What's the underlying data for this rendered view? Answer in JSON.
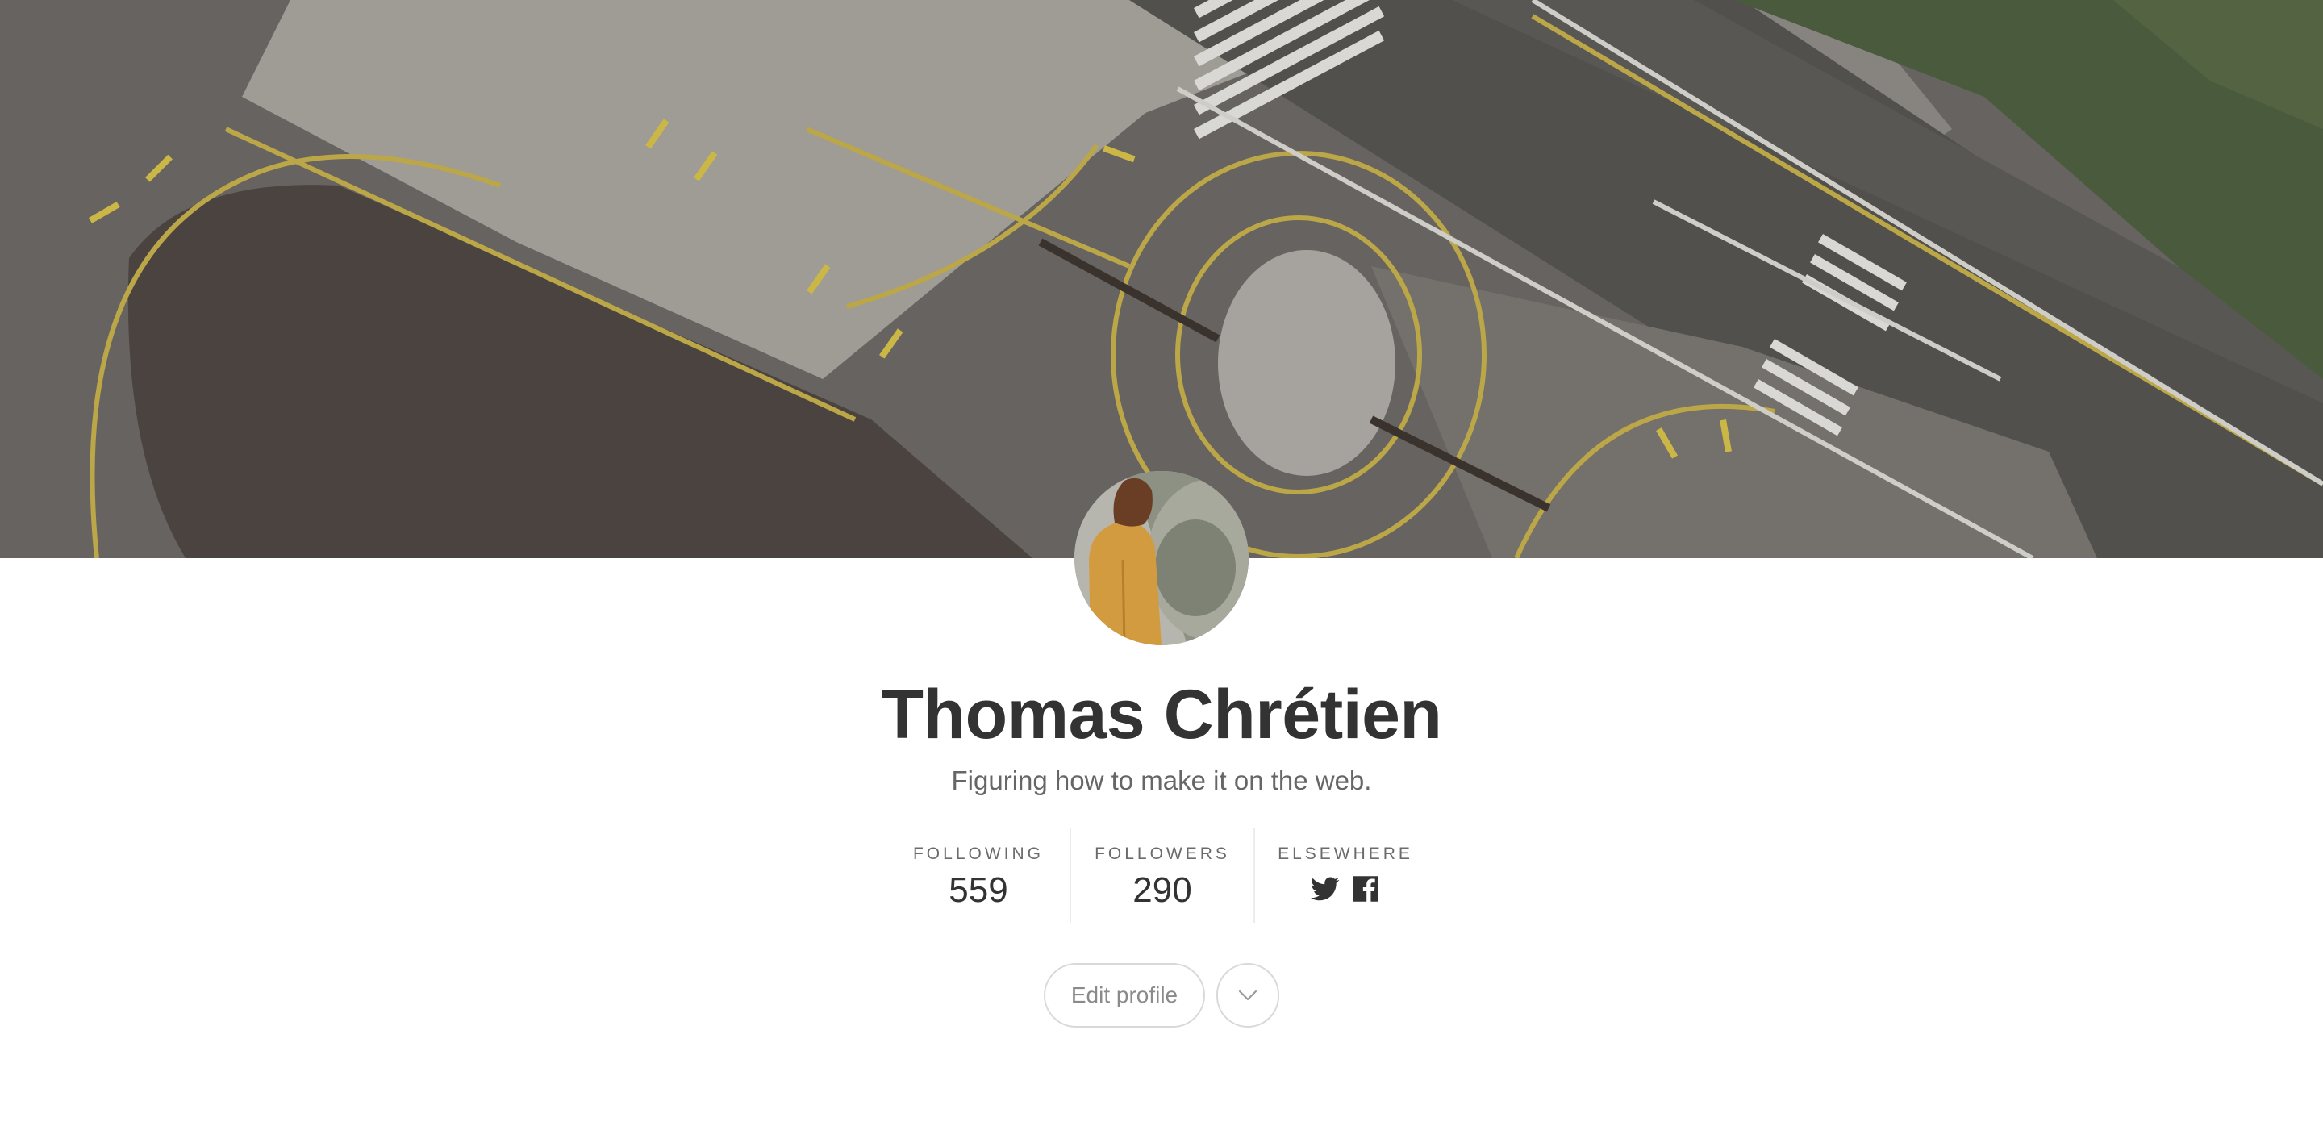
{
  "profile": {
    "name": "Thomas Chrétien",
    "bio": "Figuring how to make it on the web."
  },
  "stats": {
    "following_label": "FOLLOWING",
    "following_count": "559",
    "followers_label": "FOLLOWERS",
    "followers_count": "290",
    "elsewhere_label": "ELSEWHERE"
  },
  "social": {
    "icons": [
      "twitter-icon",
      "facebook-icon"
    ]
  },
  "actions": {
    "edit_profile_label": "Edit profile",
    "more_icon": "chevron-down-icon"
  },
  "colors": {
    "text_dark": "#333333",
    "text_muted": "#666666",
    "button_border": "#d9d9d9",
    "divider": "#ececec"
  }
}
